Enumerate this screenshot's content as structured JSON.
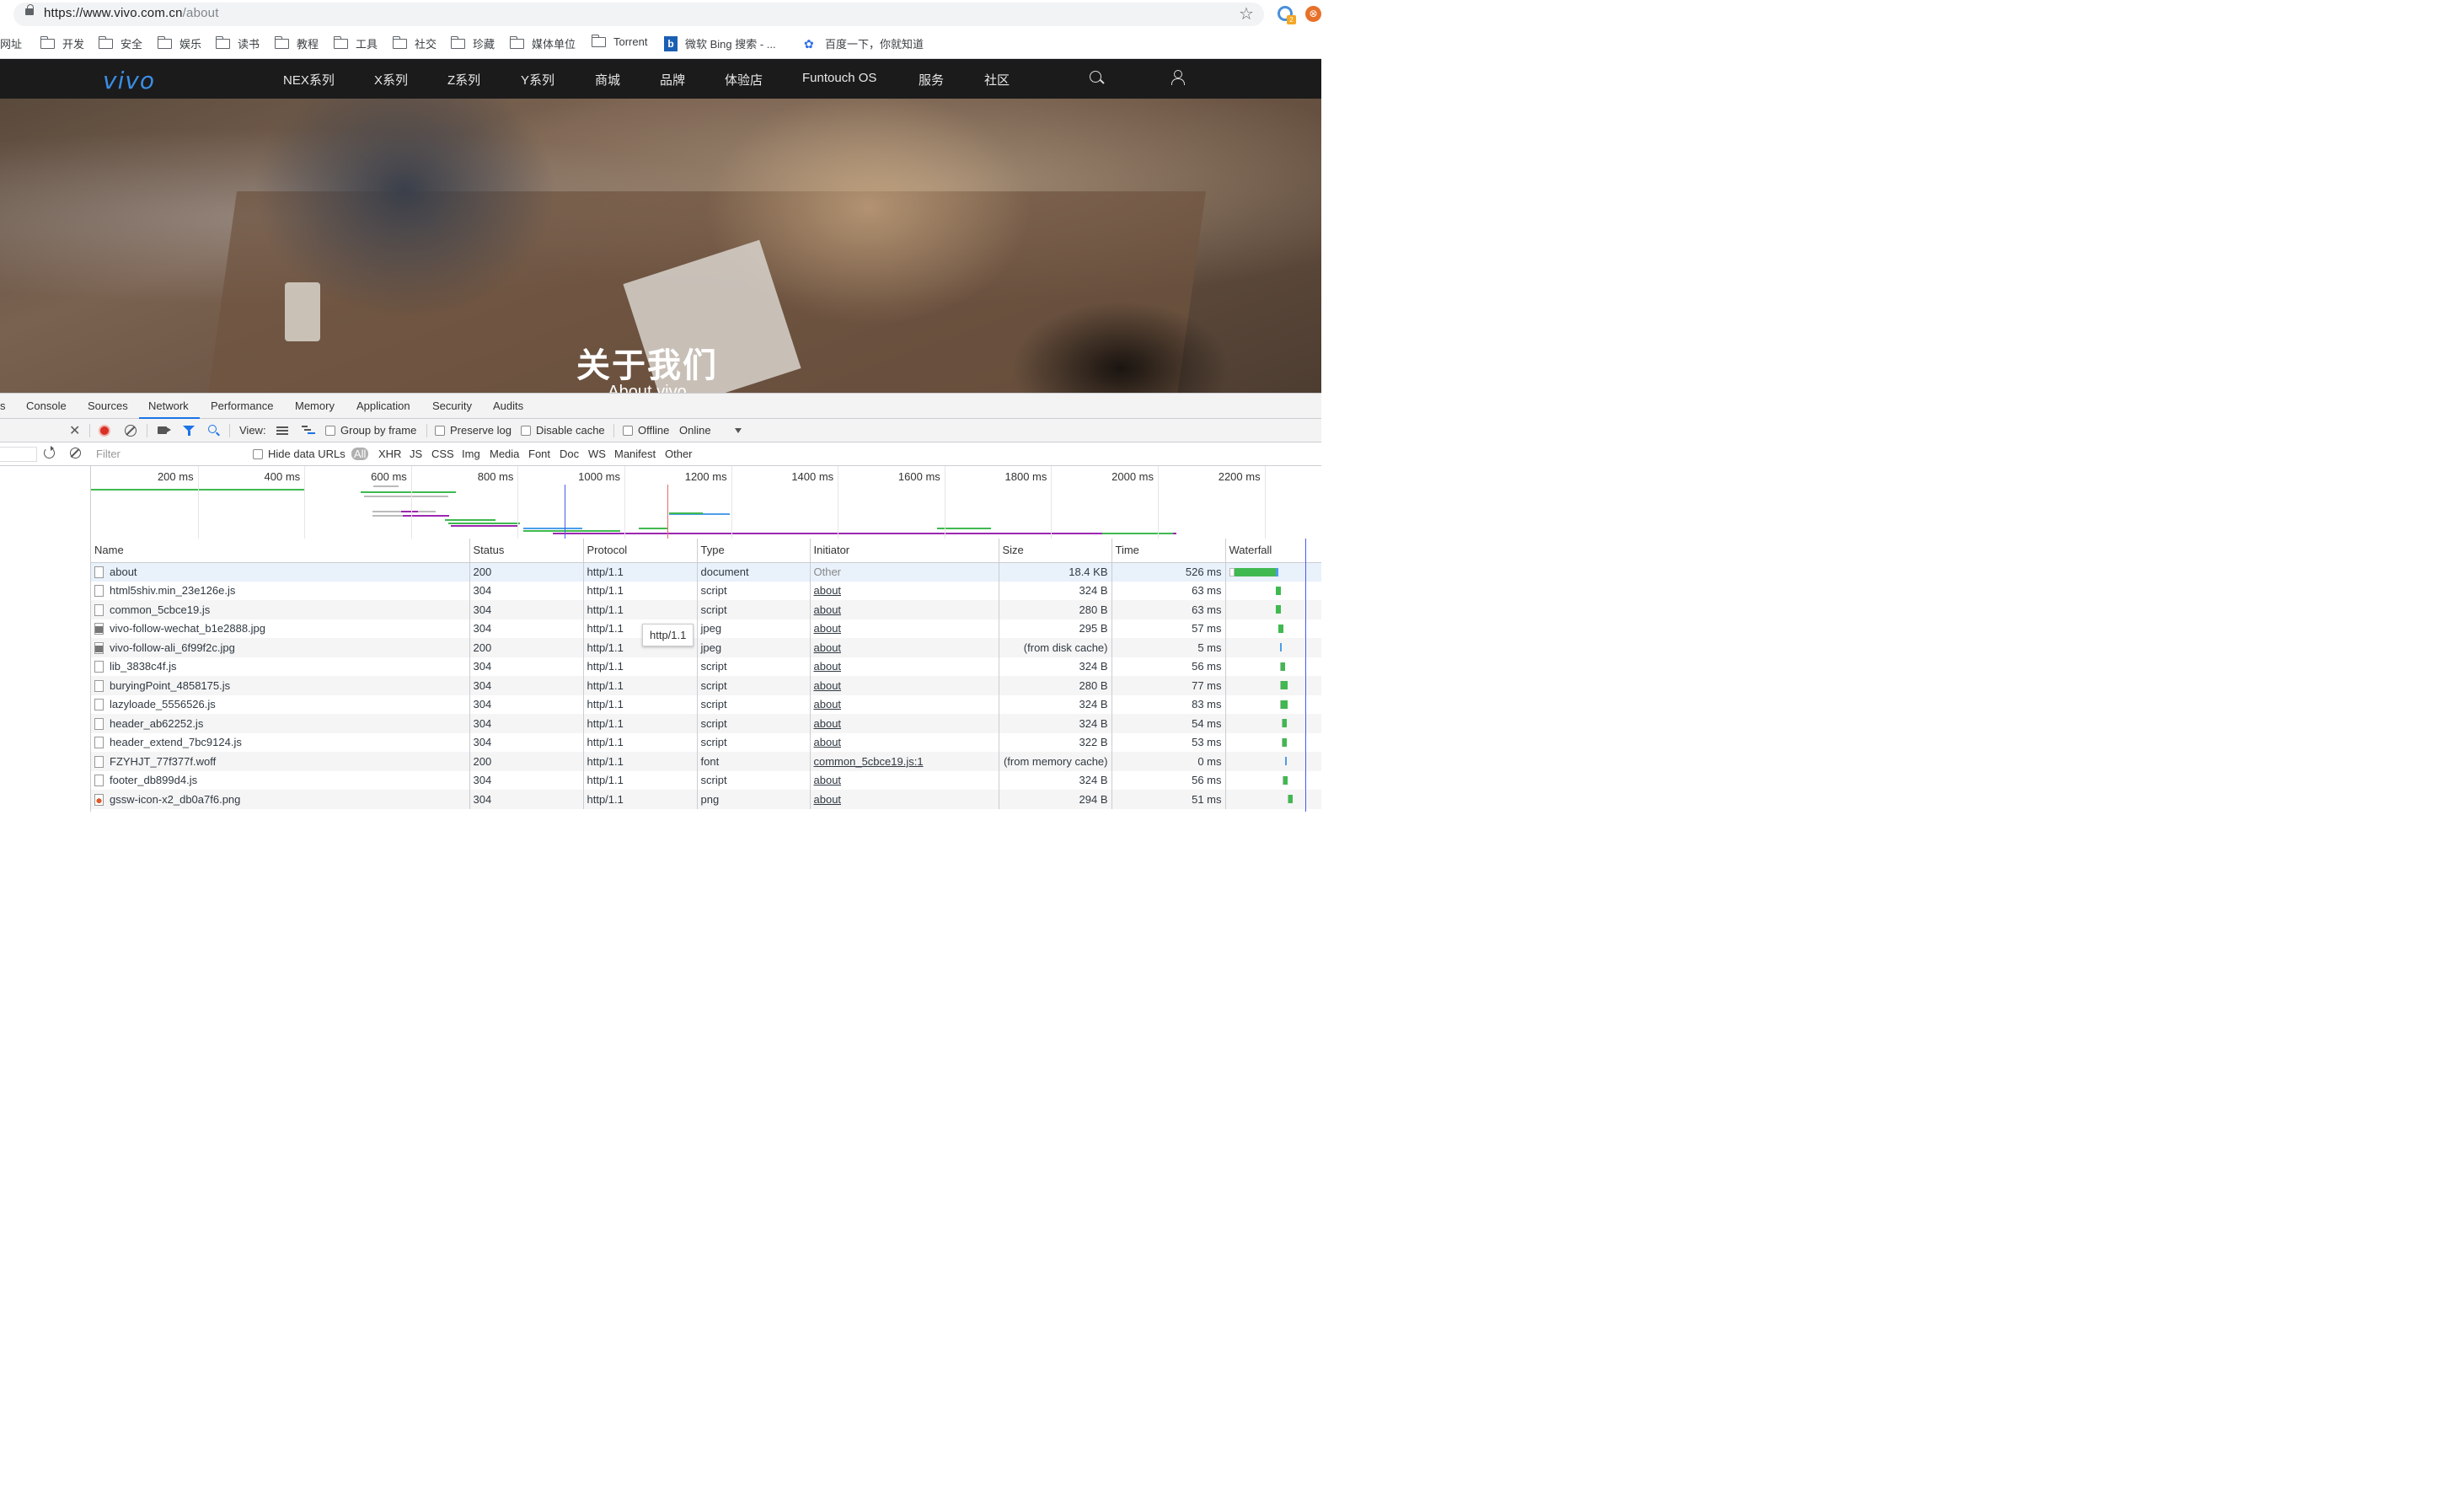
{
  "browser": {
    "url_main": "https://www.vivo.com.cn",
    "url_path": "/about",
    "ext_badge": "2"
  },
  "bookmarks": [
    "网址",
    "开发",
    "安全",
    "娱乐",
    "读书",
    "教程",
    "工具",
    "社交",
    "珍藏",
    "媒体单位",
    "Torrent",
    "微软 Bing 搜索 - ...",
    "百度一下，你就知道"
  ],
  "site": {
    "logo": "vivo",
    "nav": [
      "NEX系列",
      "X系列",
      "Z系列",
      "Y系列",
      "商城",
      "品牌",
      "体验店",
      "Funtouch OS",
      "服务",
      "社区"
    ],
    "hero_title": "关于我们",
    "hero_subtitle": "About vivo"
  },
  "devtools": {
    "tabs": [
      "s",
      "Console",
      "Sources",
      "Network",
      "Performance",
      "Memory",
      "Application",
      "Security",
      "Audits"
    ],
    "active_tab": "Network",
    "toolbar": {
      "view_label": "View:",
      "group_by_frame": "Group by frame",
      "preserve_log": "Preserve log",
      "disable_cache": "Disable cache",
      "offline": "Offline",
      "throttle": "Online"
    },
    "filter": {
      "placeholder": "Filter",
      "hide_data_urls": "Hide data URLs",
      "types": [
        "All",
        "XHR",
        "JS",
        "CSS",
        "Img",
        "Media",
        "Font",
        "Doc",
        "WS",
        "Manifest",
        "Other"
      ]
    },
    "overview_ticks": [
      "200 ms",
      "400 ms",
      "600 ms",
      "800 ms",
      "1000 ms",
      "1200 ms",
      "1400 ms",
      "1600 ms",
      "1800 ms",
      "2000 ms",
      "2200 ms"
    ],
    "columns": [
      "Name",
      "Status",
      "Protocol",
      "Type",
      "Initiator",
      "Size",
      "Time",
      "Waterfall"
    ],
    "rows": [
      {
        "name": "about",
        "status": "200",
        "protocol": "http/1.1",
        "type": "document",
        "initiator": "Other",
        "size": "18.4 KB",
        "time": "526 ms",
        "icon": "doc",
        "wf_start": 0.0,
        "wf_len": 0.19
      },
      {
        "name": "html5shiv.min_23e126e.js",
        "status": "304",
        "protocol": "http/1.1",
        "type": "script",
        "initiator": "about",
        "size": "324 B",
        "time": "63 ms",
        "icon": "doc",
        "wf_start": 0.19,
        "wf_len": 0.023
      },
      {
        "name": "common_5cbce19.js",
        "status": "304",
        "protocol": "http/1.1",
        "type": "script",
        "initiator": "about",
        "size": "280 B",
        "time": "63 ms",
        "icon": "doc",
        "wf_start": 0.19,
        "wf_len": 0.023
      },
      {
        "name": "vivo-follow-wechat_b1e2888.jpg",
        "status": "304",
        "protocol": "http/1.1",
        "type": "jpeg",
        "initiator": "about",
        "size": "295 B",
        "time": "57 ms",
        "icon": "img",
        "wf_start": 0.2,
        "wf_len": 0.021
      },
      {
        "name": "vivo-follow-ali_6f99f2c.jpg",
        "status": "200",
        "protocol": "http/1.1",
        "type": "jpeg",
        "initiator": "about",
        "size": "(from disk cache)",
        "time": "5 ms",
        "icon": "img",
        "wf_start": 0.21,
        "wf_len": 0.003
      },
      {
        "name": "lib_3838c4f.js",
        "status": "304",
        "protocol": "http/1.1",
        "type": "script",
        "initiator": "about",
        "size": "324 B",
        "time": "56 ms",
        "icon": "doc",
        "wf_start": 0.21,
        "wf_len": 0.021
      },
      {
        "name": "buryingPoint_4858175.js",
        "status": "304",
        "protocol": "http/1.1",
        "type": "script",
        "initiator": "about",
        "size": "280 B",
        "time": "77 ms",
        "icon": "doc",
        "wf_start": 0.21,
        "wf_len": 0.028
      },
      {
        "name": "lazyloade_5556526.js",
        "status": "304",
        "protocol": "http/1.1",
        "type": "script",
        "initiator": "about",
        "size": "324 B",
        "time": "83 ms",
        "icon": "doc",
        "wf_start": 0.21,
        "wf_len": 0.03
      },
      {
        "name": "header_ab62252.js",
        "status": "304",
        "protocol": "http/1.1",
        "type": "script",
        "initiator": "about",
        "size": "324 B",
        "time": "54 ms",
        "icon": "doc",
        "wf_start": 0.215,
        "wf_len": 0.02
      },
      {
        "name": "header_extend_7bc9124.js",
        "status": "304",
        "protocol": "http/1.1",
        "type": "script",
        "initiator": "about",
        "size": "322 B",
        "time": "53 ms",
        "icon": "doc",
        "wf_start": 0.215,
        "wf_len": 0.02
      },
      {
        "name": "FZYHJT_77f377f.woff",
        "status": "200",
        "protocol": "http/1.1",
        "type": "font",
        "initiator": "common_5cbce19.js:1",
        "size": "(from memory cache)",
        "time": "0 ms",
        "icon": "doc",
        "wf_start": 0.23,
        "wf_len": 0.002
      },
      {
        "name": "footer_db899d4.js",
        "status": "304",
        "protocol": "http/1.1",
        "type": "script",
        "initiator": "about",
        "size": "324 B",
        "time": "56 ms",
        "icon": "doc",
        "wf_start": 0.22,
        "wf_len": 0.021
      },
      {
        "name": "gssw-icon-x2_db0a7f6.png",
        "status": "304",
        "protocol": "http/1.1",
        "type": "png",
        "initiator": "about",
        "size": "294 B",
        "time": "51 ms",
        "icon": "png",
        "wf_start": 0.24,
        "wf_len": 0.019
      }
    ],
    "tooltip": "http/1.1",
    "colors": {
      "green": "#3fb950",
      "blue": "#4d9de8",
      "purple": "#9c27b0",
      "gray": "#bbbbbb",
      "red": "#e56b6b"
    }
  }
}
